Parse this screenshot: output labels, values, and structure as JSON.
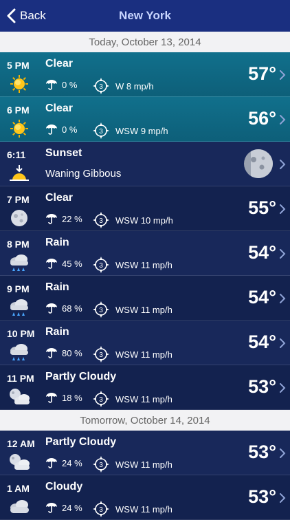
{
  "nav": {
    "back_label": "Back",
    "title": "New York"
  },
  "sections": [
    {
      "date": "Today, October 13, 2014",
      "rows": [
        {
          "kind": "hour",
          "time": "5 PM",
          "condition": "Clear",
          "icon": "sun-icon",
          "precip": "0 %",
          "wind": "W 8 mp/h",
          "temp": "57°"
        },
        {
          "kind": "hour",
          "time": "6 PM",
          "condition": "Clear",
          "icon": "sun-icon",
          "precip": "0 %",
          "wind": "WSW 9 mp/h",
          "temp": "56°"
        },
        {
          "kind": "sunset",
          "time": "6:11",
          "condition": "Sunset",
          "icon": "sunset-icon",
          "moon_phase": "Waning Gibbous"
        },
        {
          "kind": "hour",
          "time": "7 PM",
          "condition": "Clear",
          "icon": "moon-icon",
          "precip": "22 %",
          "wind": "WSW 10 mp/h",
          "temp": "55°"
        },
        {
          "kind": "hour",
          "time": "8 PM",
          "condition": "Rain",
          "icon": "rain-cloud-icon",
          "precip": "45 %",
          "wind": "WSW 11 mp/h",
          "temp": "54°"
        },
        {
          "kind": "hour",
          "time": "9 PM",
          "condition": "Rain",
          "icon": "rain-cloud-icon",
          "precip": "68 %",
          "wind": "WSW 11 mp/h",
          "temp": "54°"
        },
        {
          "kind": "hour",
          "time": "10 PM",
          "condition": "Rain",
          "icon": "rain-cloud-icon",
          "precip": "80 %",
          "wind": "WSW 11 mp/h",
          "temp": "54°"
        },
        {
          "kind": "hour",
          "time": "11 PM",
          "condition": "Partly Cloudy",
          "icon": "partly-cloudy-night-icon",
          "precip": "18 %",
          "wind": "WSW 11 mp/h",
          "temp": "53°"
        }
      ]
    },
    {
      "date": "Tomorrow, October 14, 2014",
      "rows": [
        {
          "kind": "hour",
          "time": "12 AM",
          "condition": "Partly Cloudy",
          "icon": "partly-cloudy-night-icon",
          "precip": "24 %",
          "wind": "WSW 11 mp/h",
          "temp": "53°"
        },
        {
          "kind": "hour",
          "time": "1 AM",
          "condition": "Cloudy",
          "icon": "cloud-icon",
          "precip": "24 %",
          "wind": "WSW 11 mp/h",
          "temp": "53°"
        }
      ]
    }
  ],
  "colors": {
    "navbar": "#1a2f80",
    "current_row": "#11708c",
    "row_a": "#18285a",
    "row_b": "#13224f",
    "section_header": "#f2f2f4"
  }
}
